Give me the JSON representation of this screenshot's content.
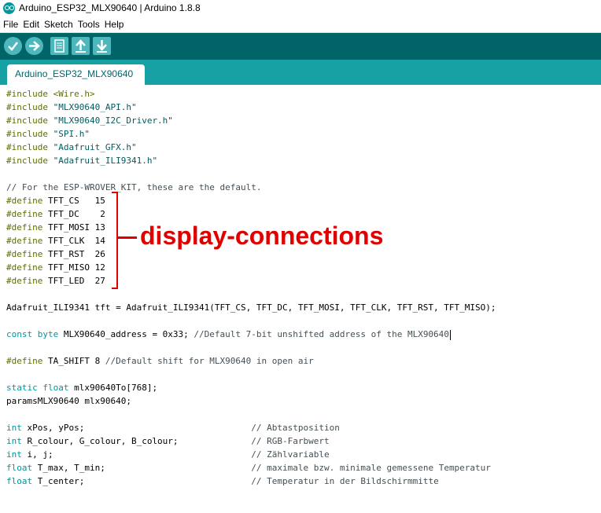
{
  "window": {
    "title": "Arduino_ESP32_MLX90640 | Arduino 1.8.8"
  },
  "menu": {
    "file": "File",
    "edit": "Edit",
    "sketch": "Sketch",
    "tools": "Tools",
    "help": "Help"
  },
  "toolbar": {
    "icons": [
      "verify-icon",
      "upload-icon",
      "new-icon",
      "open-icon",
      "save-icon"
    ]
  },
  "tabs": [
    {
      "label": "Arduino_ESP32_MLX90640"
    }
  ],
  "code": {
    "inc1_kw": "#include",
    "inc1_arg": "<Wire.h>",
    "inc2_kw": "#include",
    "inc2_arg": "\"MLX90640_API.h\"",
    "inc3_kw": "#include",
    "inc3_arg": "\"MLX90640_I2C_Driver.h\"",
    "inc4_kw": "#include",
    "inc4_arg": "\"SPI.h\"",
    "inc5_kw": "#include",
    "inc5_arg": "\"Adafruit_GFX.h\"",
    "inc6_kw": "#include",
    "inc6_arg": "\"Adafruit_ILI9341.h\"",
    "comment1": "// For the ESP-WROVER_KIT, these are the default.",
    "def1_kw": "#define",
    "def1_rest": " TFT_CS   15",
    "def2_kw": "#define",
    "def2_rest": " TFT_DC    2",
    "def3_kw": "#define",
    "def3_rest": " TFT_MOSI 13",
    "def4_kw": "#define",
    "def4_rest": " TFT_CLK  14",
    "def5_kw": "#define",
    "def5_rest": " TFT_RST  26",
    "def6_kw": "#define",
    "def6_rest": " TFT_MISO 12",
    "def7_kw": "#define",
    "def7_rest": " TFT_LED  27",
    "tft_line": "Adafruit_ILI9341 tft = Adafruit_ILI9341(TFT_CS, TFT_DC, TFT_MOSI, TFT_CLK, TFT_RST, TFT_MISO);",
    "addr_kw": "const byte",
    "addr_rest": " MLX90640_address = 0x33; ",
    "addr_comment": "//Default 7-bit unshifted address of the MLX90640",
    "shift_kw": "#define",
    "shift_rest": " TA_SHIFT 8 ",
    "shift_comment": "//Default shift for MLX90640 in open air",
    "static_kw": "static float",
    "static_rest": " mlx90640To[768];",
    "params_line": "paramsMLX90640 mlx90640;",
    "v1_kw": "int",
    "v1_rest": " xPos, yPos;                                ",
    "v1_comment": "// Abtastposition",
    "v2_kw": "int",
    "v2_rest": " R_colour, G_colour, B_colour;              ",
    "v2_comment": "// RGB-Farbwert",
    "v3_kw": "int",
    "v3_rest": " i, j;                                      ",
    "v3_comment": "// Zählvariable",
    "v4_kw": "float",
    "v4_rest": " T_max, T_min;                            ",
    "v4_comment": "// maximale bzw. minimale gemessene Temperatur",
    "v5_kw": "float",
    "v5_rest": " T_center;                                ",
    "v5_comment": "// Temperatur in der Bildschirmmitte"
  },
  "annotation": {
    "text": "display-connections",
    "color": "#e00000"
  },
  "colors": {
    "toolbar": "#006468",
    "tabstrip": "#17a1a5",
    "button": "#4db7bb",
    "preprocessor": "#5e6d03",
    "keyword": "#00979c",
    "string": "#005c5f"
  }
}
